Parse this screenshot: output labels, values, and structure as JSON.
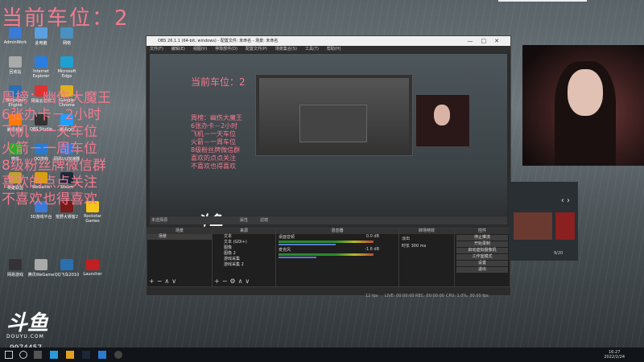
{
  "overlay": {
    "title": "当前车位：2",
    "lines": [
      "周榜：幽伤大魔王",
      "6张办卡－2小时",
      "飞机－一天车位",
      "火箭－一周车位",
      "8级粉丝牌微信群",
      "喜欢的点点关注",
      "不喜欢也得喜欢"
    ]
  },
  "desktop_icons": [
    {
      "label": "AdminWork",
      "color": "#3a7bd5"
    },
    {
      "label": "此电脑",
      "color": "#5aa0e0"
    },
    {
      "label": "网络",
      "color": "#4a90c0"
    },
    {
      "label": "回收站",
      "color": "#aaaaaa"
    },
    {
      "label": "Internet Explorer",
      "color": "#2b7de0"
    },
    {
      "label": "Microsoft Edge",
      "color": "#1fa0d0"
    },
    {
      "label": "Wallpaper Engine",
      "color": "#2a6fb0"
    },
    {
      "label": "网易云音乐",
      "color": "#d33"
    },
    {
      "label": "Google Chrome",
      "color": "#e0b020"
    },
    {
      "label": "腾讯视频",
      "color": "#ff7a00"
    },
    {
      "label": "OBS Studio",
      "color": "#333"
    },
    {
      "label": "腾讯QQ",
      "color": "#1ea0ff"
    },
    {
      "label": "微信",
      "color": "#2aae2a"
    },
    {
      "label": "QQ游戏",
      "color": "#2a7ad0"
    },
    {
      "label": "网易UU加速器",
      "color": "#3a7bd5"
    },
    {
      "label": "英雄联盟",
      "color": "#c0a030"
    },
    {
      "label": "WeGame",
      "color": "#d8a010"
    },
    {
      "label": "Steam",
      "color": "#1b2838"
    },
    {
      "label": "3D游戏平台",
      "color": "#3a7bd5"
    },
    {
      "label": "荒野大镖客2",
      "color": "#7a1a1a"
    },
    {
      "label": "Rockstar Games",
      "color": "#f5c518"
    },
    {
      "label": "网易游戏",
      "color": "#333"
    },
    {
      "label": "腾讯WeGame",
      "color": "#aaa"
    },
    {
      "label": "QQ飞车2010",
      "color": "#2a6fb0"
    },
    {
      "label": "Launcher",
      "color": "#c02020"
    }
  ],
  "obs": {
    "title": "OBS 26.1.1 (64-bit, windows) - 配置文件: 未命名 - 场景: 未命名",
    "menu": [
      "文件(F)",
      "编辑(E)",
      "视图(V)",
      "停靠部件(D)",
      "配置文件(P)",
      "场景集合(S)",
      "工具(T)",
      "帮助(H)"
    ],
    "scene_name": "未选择源",
    "scene_btn_props": "属性",
    "scene_btn_filters": "滤镜",
    "panels": {
      "scenes": "场景",
      "sources": "来源",
      "mixer": "混音器",
      "transitions": "转场特效",
      "controls": "控件"
    },
    "scenes_list": [
      "场景"
    ],
    "sources_list": [
      "文本",
      "文本 (GDI+)",
      "图像",
      "图像 2",
      "游戏采集",
      "游戏采集 2"
    ],
    "mixer": [
      {
        "name": "桌面音频",
        "db": "0.0 dB",
        "level": 0.6
      },
      {
        "name": "麦克风",
        "db": "-1.6 dB",
        "level": 0.4
      }
    ],
    "transition": {
      "type": "淡出",
      "duration_label": "时长",
      "duration": "300 ms"
    },
    "controls": [
      "停止推流",
      "开始录制",
      "启动虚拟摄像机",
      "工作室模式",
      "设置",
      "退出"
    ],
    "status": {
      "live": "LIVE: 00:00:00",
      "rec": "REC: 00:00:00",
      "cpu": "CPU: 1.0%, 30.00 fps",
      "kbps": "12 fps"
    }
  },
  "nested_preview": {
    "title": "当前车位：2",
    "lines": [
      "周榜：幽伤大魔王",
      "6张办卡－2小时",
      "飞机－一天车位",
      "火箭－一周车位",
      "8级粉丝牌微信群",
      "喜欢的点点关注",
      "不喜欢也得喜欢"
    ]
  },
  "side": {
    "count": "9/20"
  },
  "brand": {
    "logo": "斗鱼",
    "sub": "DOUYU.COM",
    "room_id": "9974457"
  },
  "clock": {
    "time": "16:27",
    "date": "2022/2/24"
  }
}
